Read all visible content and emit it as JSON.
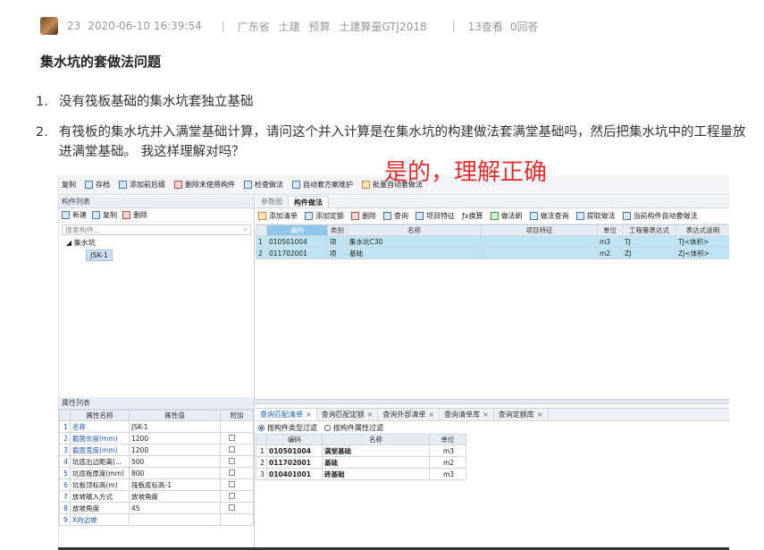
{
  "meta": {
    "score": "23",
    "datetime": "2020-06-10 16:39:54",
    "separator": "|",
    "tags": [
      "广东省",
      "土建",
      "预算",
      "土建算量GTJ2018"
    ],
    "views": "13查看",
    "answers": "0回答"
  },
  "title": "集水坑的套做法问题",
  "questions": [
    {
      "num": "1.",
      "text": "没有筏板基础的集水坑套独立基础"
    },
    {
      "num": "2.",
      "text": "有筏板的集水坑并入满堂基础计算，请问这个并入计算是在集水坑的构建做法套满堂基础吗，然后把集水坑中的工程量放进满堂基础。 我这样理解对吗？"
    }
  ],
  "answer_overlay": "是的，理解正确",
  "software": {
    "toolbar": [
      "复制",
      "存档",
      "添加前后缀",
      "删除未使用构件",
      "检查做法",
      "自动套方案维护",
      "批量自动套做法"
    ],
    "left_panel": {
      "header": "构件列表",
      "buttons": [
        "新建",
        "复制",
        "删除"
      ],
      "search_placeholder": "搜索构件...",
      "tree_root": "集水坑",
      "tree_child": "JSK-1"
    },
    "right_panel": {
      "tabs": [
        "参数图",
        "构件做法"
      ],
      "toolbar": [
        "添加清单",
        "添加定额",
        "删除",
        "查询",
        "项目特征",
        "换算",
        "做法刷",
        "做法查询",
        "提取做法",
        "当前构件自动套做法"
      ],
      "columns": [
        "",
        "编码",
        "类别",
        "名称",
        "项目特征",
        "单位",
        "工程量表达式",
        "表达式说明"
      ],
      "rows": [
        {
          "no": "1",
          "code": "010501004",
          "type": "项",
          "name": "集水坑C30",
          "feature": "",
          "unit": "m3",
          "expr": "TJ",
          "desc": "TJ<体积>"
        },
        {
          "no": "2",
          "code": "011702001",
          "type": "项",
          "name": "基础",
          "feature": "",
          "unit": "m2",
          "expr": "ZJ",
          "desc": "ZJ<体积>"
        }
      ]
    },
    "prop_panel": {
      "header": "属性列表",
      "columns": [
        "",
        "属性名称",
        "属性值",
        "附加"
      ],
      "rows": [
        {
          "no": "1",
          "name": "名称",
          "value": "JSK-1",
          "check": false,
          "blue": true
        },
        {
          "no": "2",
          "name": "截面长度(mm)",
          "value": "1200",
          "check": true,
          "blue": true
        },
        {
          "no": "3",
          "name": "截面宽度(mm)",
          "value": "1200",
          "check": true,
          "blue": true
        },
        {
          "no": "4",
          "name": "坑底出边距离(...",
          "value": "500",
          "check": true,
          "blue": false
        },
        {
          "no": "5",
          "name": "坑底板厚度(mm)",
          "value": "800",
          "check": true,
          "blue": false
        },
        {
          "no": "6",
          "name": "坑板顶标高(m)",
          "value": "筏板底标高-1",
          "check": true,
          "blue": false
        },
        {
          "no": "7",
          "name": "放坡输入方式",
          "value": "放坡角度",
          "check": true,
          "blue": false
        },
        {
          "no": "8",
          "name": "放坡角度",
          "value": "45",
          "check": true,
          "blue": false
        },
        {
          "no": "9",
          "name": "X向边坡",
          "value": "",
          "check": false,
          "blue": true
        }
      ]
    },
    "query_panel": {
      "tabs": [
        "查询匹配清单",
        "查询匹配定额",
        "查询外部清单",
        "查询清单库",
        "查询定额库"
      ],
      "close_glyph": "×",
      "radio_1": "按构件类型过滤",
      "radio_2": "按构件属性过滤",
      "columns": [
        "",
        "编码",
        "名称",
        "单位"
      ],
      "rows": [
        {
          "no": "1",
          "code": "010501004",
          "name": "满堂基础",
          "unit": "m3"
        },
        {
          "no": "2",
          "code": "011702001",
          "name": "基础",
          "unit": "m2"
        },
        {
          "no": "3",
          "code": "010401001",
          "name": "砖基础",
          "unit": "m3"
        }
      ]
    }
  }
}
